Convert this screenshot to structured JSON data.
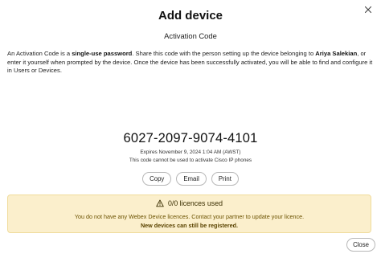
{
  "dialog": {
    "title": "Add device",
    "subtitle": "Activation Code",
    "description": {
      "p1": "An Activation Code is a ",
      "b1": "single-use password",
      "p2": ". Share this code with the person setting up the device belonging to ",
      "b2": "Ariya Salekian",
      "p3": ", or enter it yourself when prompted by the device. Once the device has been successfully activated, you will be able to find and configure it in Users or Devices."
    },
    "code": "6027-2097-9074-4101",
    "expires": "Expires November 9, 2024 1:04 AM (AWST)",
    "restriction": "This code cannot be used to activate Cisco IP phones",
    "buttons": {
      "copy": "Copy",
      "email": "Email",
      "print": "Print"
    },
    "banner": {
      "heading": "0/0 licences used",
      "line1": "You do not have any Webex Device licences. Contact your partner to update your licence.",
      "line2": "New devices can still be registered."
    },
    "close_label": "Close"
  },
  "icons": {
    "dismiss": "close-icon",
    "warning": "warning-icon"
  },
  "colors": {
    "banner_bg": "#fbefcc",
    "banner_border": "#f0dc9c",
    "banner_text": "#6b5200"
  }
}
